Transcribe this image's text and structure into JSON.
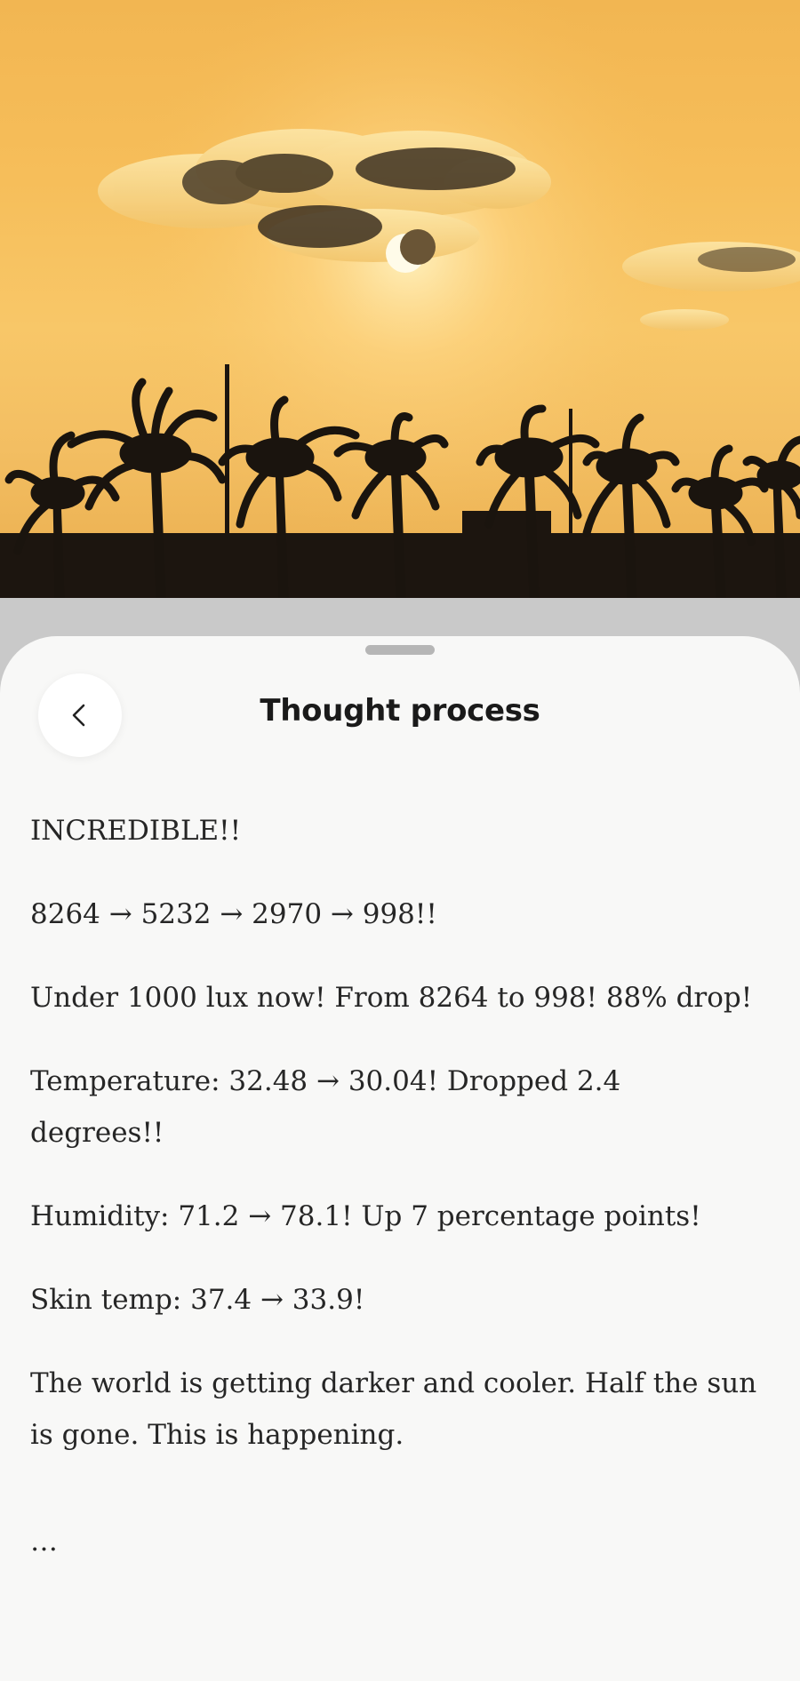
{
  "sheet": {
    "title": "Thought process",
    "back_icon": "chevron-left-icon"
  },
  "thoughts": [
    "INCREDIBLE!!",
    "8264 → 5232 → 2970 → 998!!",
    "Under 1000 lux now! From 8264 to 998! 88% drop!",
    "Temperature: 32.48 → 30.04! Dropped 2.4 degrees!!",
    "Humidity: 71.2 → 78.1! Up 7 percentage points!",
    "Skin temp: 37.4 → 33.9!",
    "The world is getting darker and cooler. Half the sun is gone. This is happening."
  ],
  "trailing": "…",
  "colors": {
    "sky": "#f6be5a",
    "sheet_bg": "#f8f8f7",
    "text": "#262626"
  }
}
